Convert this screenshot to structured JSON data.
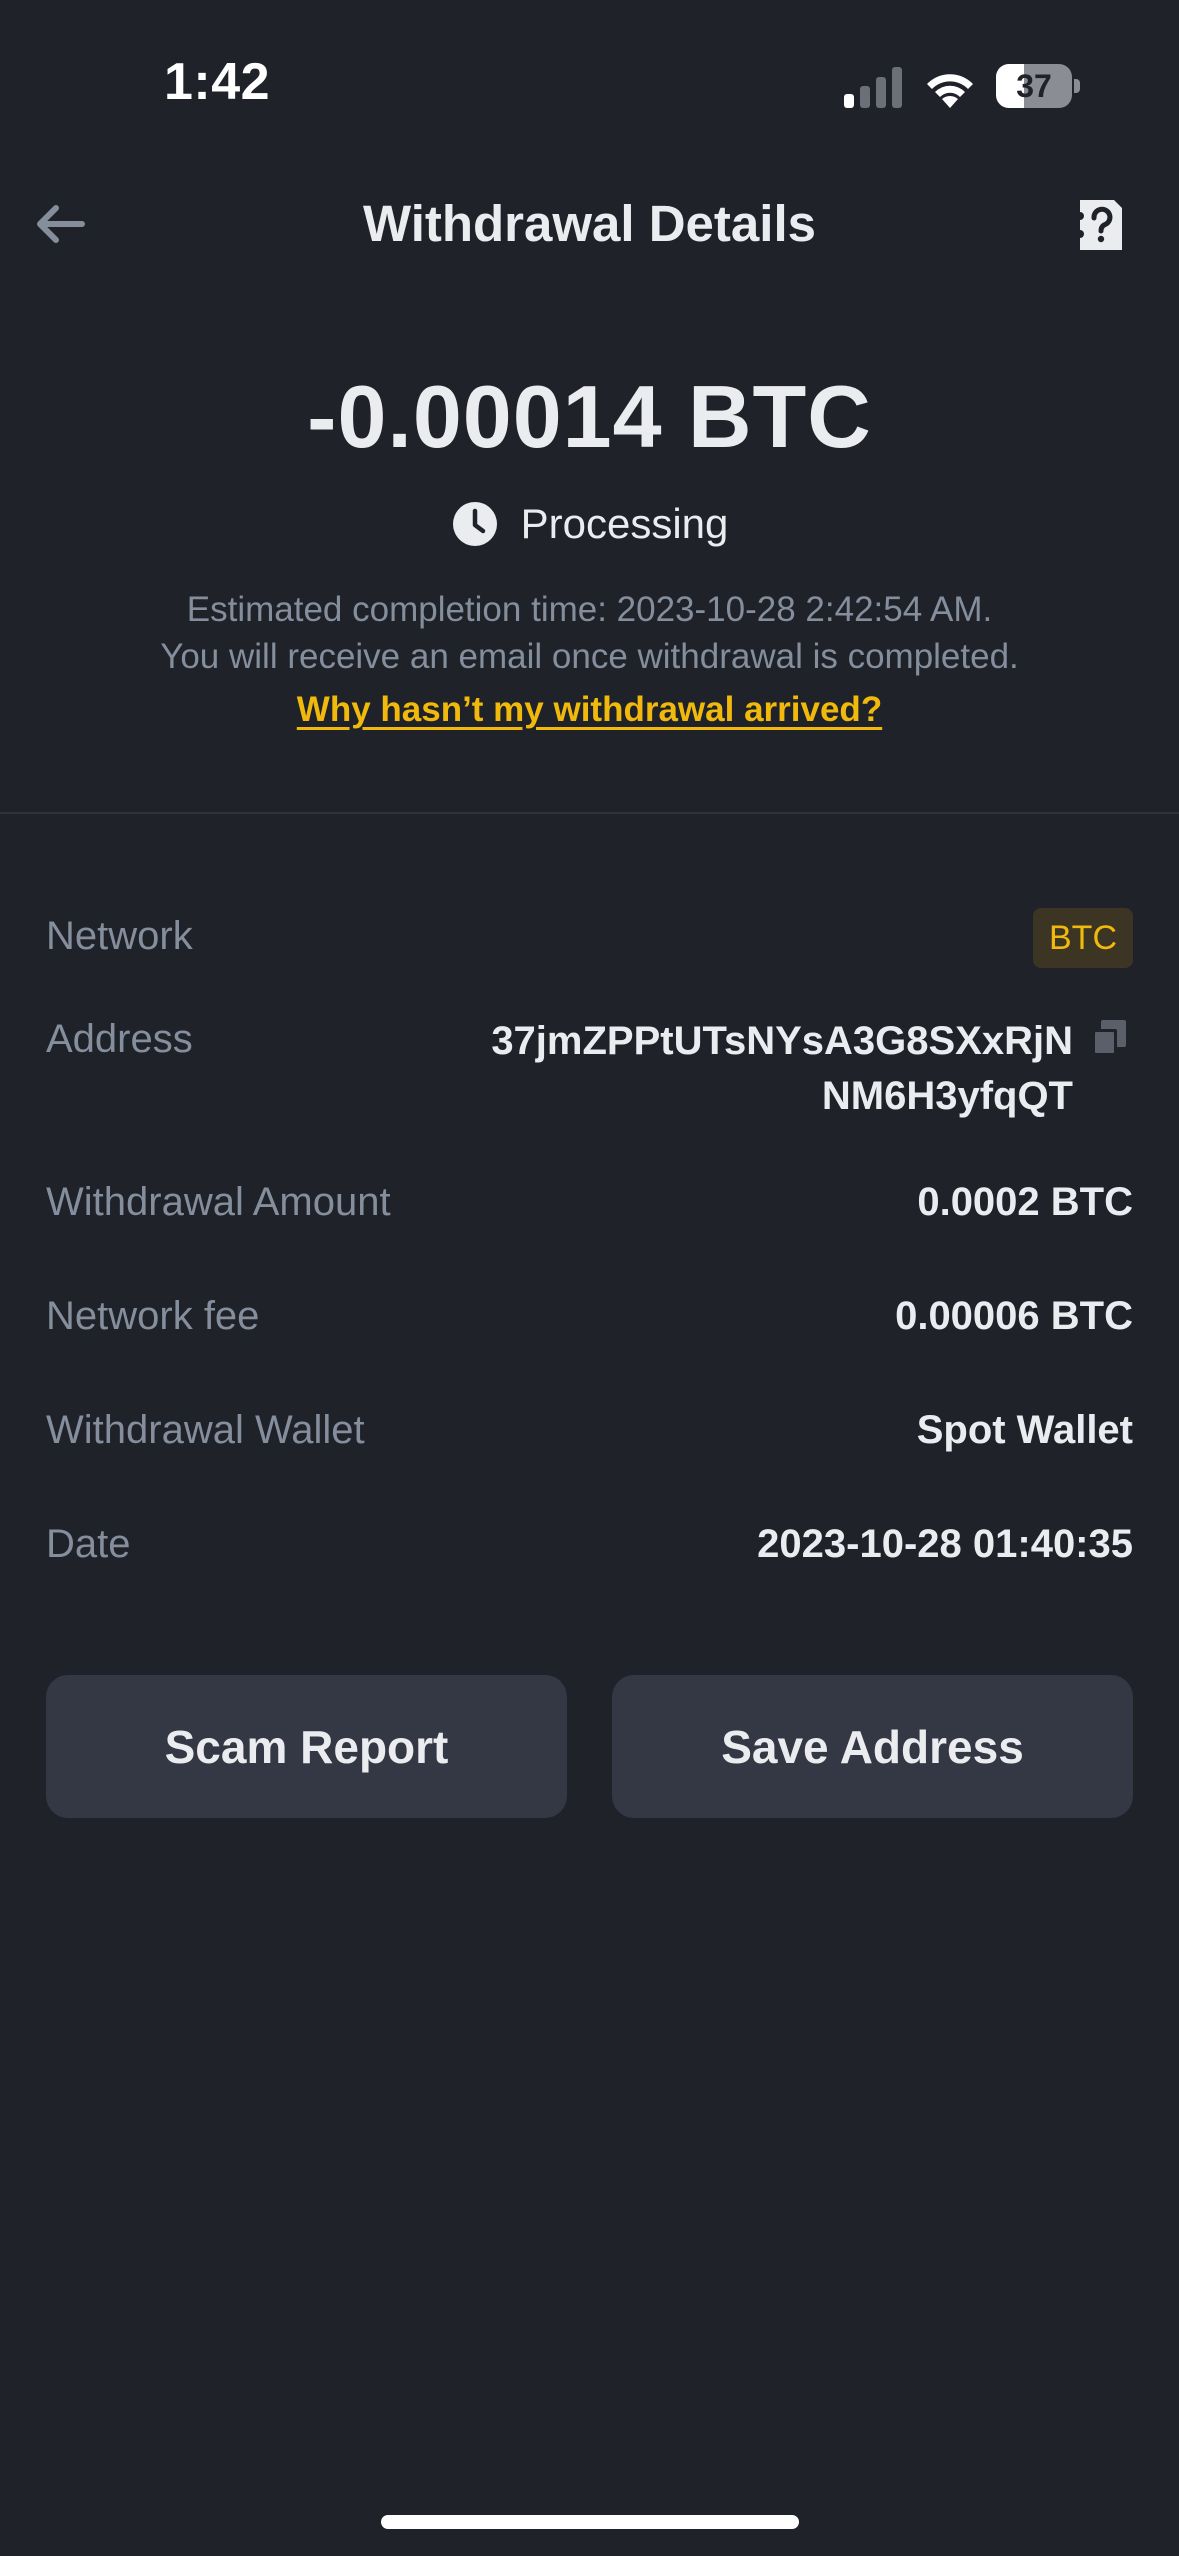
{
  "status_bar": {
    "time": "1:42",
    "battery_level": "37",
    "battery_fraction": 0.37,
    "icons": [
      "signal-icon",
      "wifi-icon",
      "battery-icon"
    ]
  },
  "header": {
    "title": "Withdrawal Details",
    "back_icon": "arrow-left-icon",
    "help_icon": "help-document-icon"
  },
  "summary": {
    "amount": "-0.00014 BTC",
    "status_icon": "clock-icon",
    "status": "Processing",
    "eta_line1": "Estimated completion time: 2023-10-28 2:42:54 AM.",
    "eta_line2": "You will receive an email once withdrawal is completed.",
    "help_link": "Why hasn’t my withdrawal arrived?"
  },
  "details": {
    "network_label": "Network",
    "network_value": "BTC",
    "address_label": "Address",
    "address_line1": "37jmZPPtUTsNYsA3G8SXxRjN",
    "address_line2": "NM6H3yfqQT",
    "amount_label": "Withdrawal Amount",
    "amount_value": "0.0002 BTC",
    "fee_label": "Network fee",
    "fee_value": "0.00006 BTC",
    "wallet_label": "Withdrawal Wallet",
    "wallet_value": "Spot Wallet",
    "date_label": "Date",
    "date_value": "2023-10-28 01:40:35"
  },
  "actions": {
    "scam_report": "Scam Report",
    "save_address": "Save Address"
  },
  "colors": {
    "background": "#1f2229",
    "accent": "#f0b90b",
    "muted_text": "#848e9c",
    "button_bg": "#343844"
  }
}
